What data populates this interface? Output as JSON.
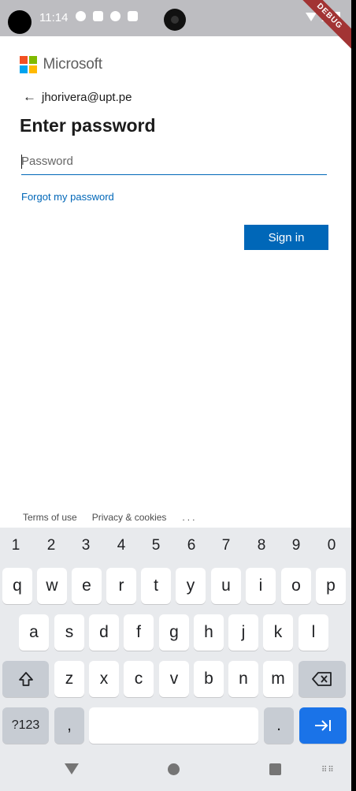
{
  "status_bar": {
    "time": "11:14",
    "debug_label": "DEBUG"
  },
  "brand": {
    "name": "Microsoft",
    "colors": [
      "#f25022",
      "#7fba00",
      "#00a4ef",
      "#ffb900"
    ]
  },
  "account": {
    "email": "jhorivera@upt.pe",
    "back_icon": "arrow-left-icon"
  },
  "form": {
    "heading": "Enter password",
    "password_placeholder": "Password",
    "password_value": "",
    "forgot_link": "Forgot my password",
    "submit_label": "Sign in",
    "accent": "#0067b8"
  },
  "footer": {
    "terms": "Terms of use",
    "privacy": "Privacy & cookies",
    "more": "..."
  },
  "keyboard": {
    "numbers": [
      "1",
      "2",
      "3",
      "4",
      "5",
      "6",
      "7",
      "8",
      "9",
      "0"
    ],
    "row1": [
      "q",
      "w",
      "e",
      "r",
      "t",
      "y",
      "u",
      "i",
      "o",
      "p"
    ],
    "row2": [
      "a",
      "s",
      "d",
      "f",
      "g",
      "h",
      "j",
      "k",
      "l"
    ],
    "row3": [
      "z",
      "x",
      "c",
      "v",
      "b",
      "n",
      "m"
    ],
    "symbols_label": "?123",
    "comma": ",",
    "period": ".",
    "shift_icon": "shift-icon",
    "backspace_icon": "backspace-icon",
    "enter_icon": "tab-next-icon"
  }
}
